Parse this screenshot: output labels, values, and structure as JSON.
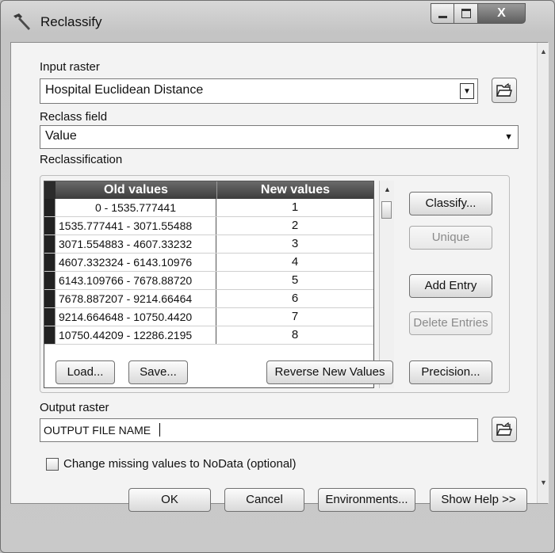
{
  "window": {
    "title": "Reclassify",
    "close_glyph": "X"
  },
  "form": {
    "input_raster_label": "Input raster",
    "input_raster_value": "Hospital Euclidean Distance",
    "reclass_field_label": "Reclass field",
    "reclass_field_value": "Value",
    "reclassification_label": "Reclassification",
    "output_raster_label": "Output raster",
    "output_raster_value": "OUTPUT FILE NAME",
    "missing_values_label": "Change missing values to NoData (optional)",
    "missing_values_checked": false
  },
  "table": {
    "columns": [
      "Old values",
      "New values"
    ],
    "rows": [
      {
        "old": "0 - 1535.777441",
        "new": "1"
      },
      {
        "old": "1535.777441 - 3071.55488",
        "new": "2"
      },
      {
        "old": "3071.554883 - 4607.33232",
        "new": "3"
      },
      {
        "old": "4607.332324 - 6143.10976",
        "new": "4"
      },
      {
        "old": "6143.109766 - 7678.88720",
        "new": "5"
      },
      {
        "old": "7678.887207 - 9214.66464",
        "new": "6"
      },
      {
        "old": "9214.664648 - 10750.4420",
        "new": "7"
      },
      {
        "old": "10750.44209 - 12286.2195",
        "new": "8"
      }
    ]
  },
  "buttons": {
    "classify": "Classify...",
    "unique": "Unique",
    "add_entry": "Add Entry",
    "delete_entries": "Delete Entries",
    "load": "Load...",
    "save": "Save...",
    "reverse": "Reverse New Values",
    "precision": "Precision...",
    "ok": "OK",
    "cancel": "Cancel",
    "environments": "Environments...",
    "show_help": "Show Help >>"
  },
  "icons": {
    "title": "hammer-icon",
    "browse": "folder-open-icon"
  }
}
